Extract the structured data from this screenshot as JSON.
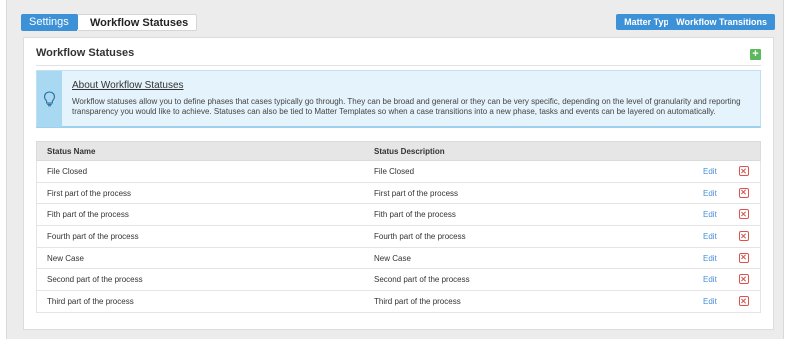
{
  "breadcrumb": {
    "root": "Settings",
    "current": "Workflow Statuses"
  },
  "toolbar": {
    "matter_types": "Matter Types",
    "workflow_transitions": "Workflow Transitions"
  },
  "panel": {
    "title": "Workflow Statuses",
    "add_icon": "plus-icon"
  },
  "info": {
    "icon": "lightbulb-icon",
    "title": "About Workflow Statuses",
    "text": "Workflow statuses allow you to define phases that cases typically go through. They can be broad and general or they can be very specific, depending on the level of granularity and reporting transparency you would like to achieve. Statuses can also be tied to Matter Templates so when a case transitions into a new phase, tasks and events can be layered on automatically."
  },
  "table": {
    "headers": {
      "name": "Status Name",
      "description": "Status Description"
    },
    "edit_label": "Edit",
    "rows": [
      {
        "name": "File Closed",
        "description": "File Closed"
      },
      {
        "name": "First part of the process",
        "description": "First part of the process"
      },
      {
        "name": "Fith part of the process",
        "description": "Fith part of the process"
      },
      {
        "name": "Fourth part of the process",
        "description": "Fourth part of the process"
      },
      {
        "name": "New Case",
        "description": "New Case"
      },
      {
        "name": "Second part of the process",
        "description": "Second part of the process"
      },
      {
        "name": "Third part of the process",
        "description": "Third part of the process"
      }
    ]
  },
  "colors": {
    "accent": "#3d91d6",
    "add": "#5cb85c",
    "delete": "#d9534f",
    "info_bg": "#e4f3fc"
  }
}
